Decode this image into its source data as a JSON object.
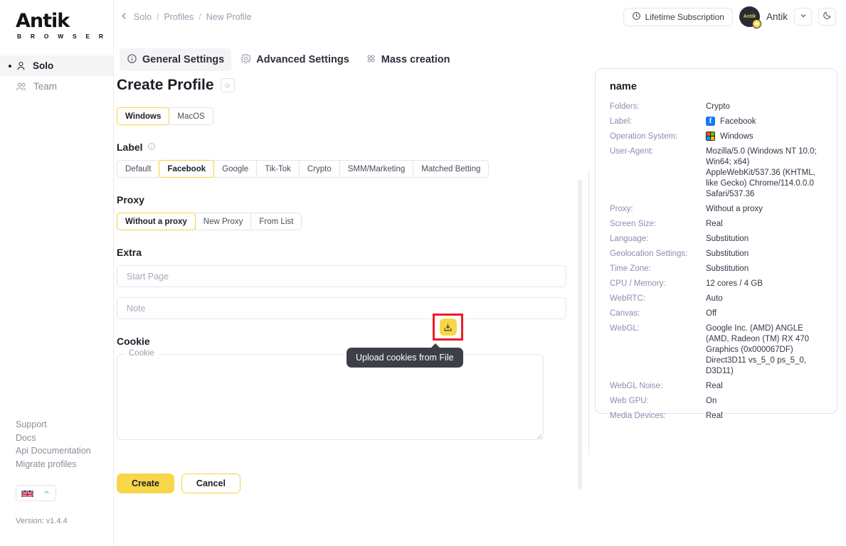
{
  "brand": {
    "name": "Antik",
    "subtitle": "B R O W S E R"
  },
  "breadcrumb": {
    "items": [
      "Solo",
      "Profiles",
      "New Profile"
    ],
    "separator": "/"
  },
  "topbar": {
    "subscription_label": "Lifetime Subscription",
    "username": "Antik",
    "avatar_text": "Antik"
  },
  "sidebar": {
    "items": [
      {
        "label": "Solo",
        "active": true
      },
      {
        "label": "Team",
        "active": false
      }
    ],
    "links": [
      "Support",
      "Docs",
      "Api Documentation",
      "Migrate profiles"
    ],
    "version": "Version: v1.4.4"
  },
  "tabs": [
    {
      "label": "General Settings",
      "active": true
    },
    {
      "label": "Advanced Settings",
      "active": false
    },
    {
      "label": "Mass creation",
      "active": false
    }
  ],
  "form": {
    "title": "Create Profile",
    "os_options": [
      "Windows",
      "MacOS"
    ],
    "os_selected": "Windows",
    "label_heading": "Label",
    "label_options": [
      "Default",
      "Facebook",
      "Google",
      "Tik-Tok",
      "Crypto",
      "SMM/Marketing",
      "Matched Betting"
    ],
    "label_selected": "Facebook",
    "proxy_heading": "Proxy",
    "proxy_options": [
      "Without a proxy",
      "New Proxy",
      "From List"
    ],
    "proxy_selected": "Without a proxy",
    "extra_heading": "Extra",
    "start_page_placeholder": "Start Page",
    "start_page_value": "",
    "note_placeholder": "Note",
    "note_value": "",
    "cookie_heading": "Cookie",
    "cookie_legend": "Cookie",
    "cookie_value": "",
    "upload_tooltip": "Upload cookies from File",
    "create_label": "Create",
    "cancel_label": "Cancel"
  },
  "panel": {
    "title": "name",
    "rows": [
      {
        "key": "Folders:",
        "value": "Crypto"
      },
      {
        "key": "Label:",
        "value": "Facebook",
        "icon": "facebook-icon"
      },
      {
        "key": "Operation System:",
        "value": "Windows",
        "icon": "windows-icon"
      },
      {
        "key": "User-Agent:",
        "value": "Mozilla/5.0 (Windows NT 10.0; Win64; x64) AppleWebKit/537.36 (KHTML, like Gecko) Chrome/114.0.0.0 Safari/537.36",
        "multiline": true
      },
      {
        "key": "Proxy:",
        "value": "Without a proxy"
      },
      {
        "key": "Screen Size:",
        "value": "Real"
      },
      {
        "key": "Language:",
        "value": "Substitution"
      },
      {
        "key": "Geolocation Settings:",
        "value": "Substitution"
      },
      {
        "key": "Time Zone:",
        "value": "Substitution"
      },
      {
        "key": "CPU / Memory:",
        "value": "12 cores / 4 GB"
      },
      {
        "key": "WebRTC:",
        "value": "Auto"
      },
      {
        "key": "Canvas:",
        "value": "Off"
      },
      {
        "key": "WebGL:",
        "value": "Google Inc. (AMD) ANGLE (AMD, Radeon (TM) RX 470 Graphics (0x000067DF) Direct3D11 vs_5_0 ps_5_0, D3D11)",
        "multiline": true
      },
      {
        "key": "WebGL Noise:",
        "value": "Real"
      },
      {
        "key": "Web GPU:",
        "value": "On"
      },
      {
        "key": "Media Devices:",
        "value": "Real"
      }
    ]
  },
  "colors": {
    "accent": "#f7d64a",
    "accent_border": "#f5d33d",
    "annotation_red": "#ef1a26",
    "tooltip_bg": "#3c3f46",
    "facebook_blue": "#1877f2"
  }
}
